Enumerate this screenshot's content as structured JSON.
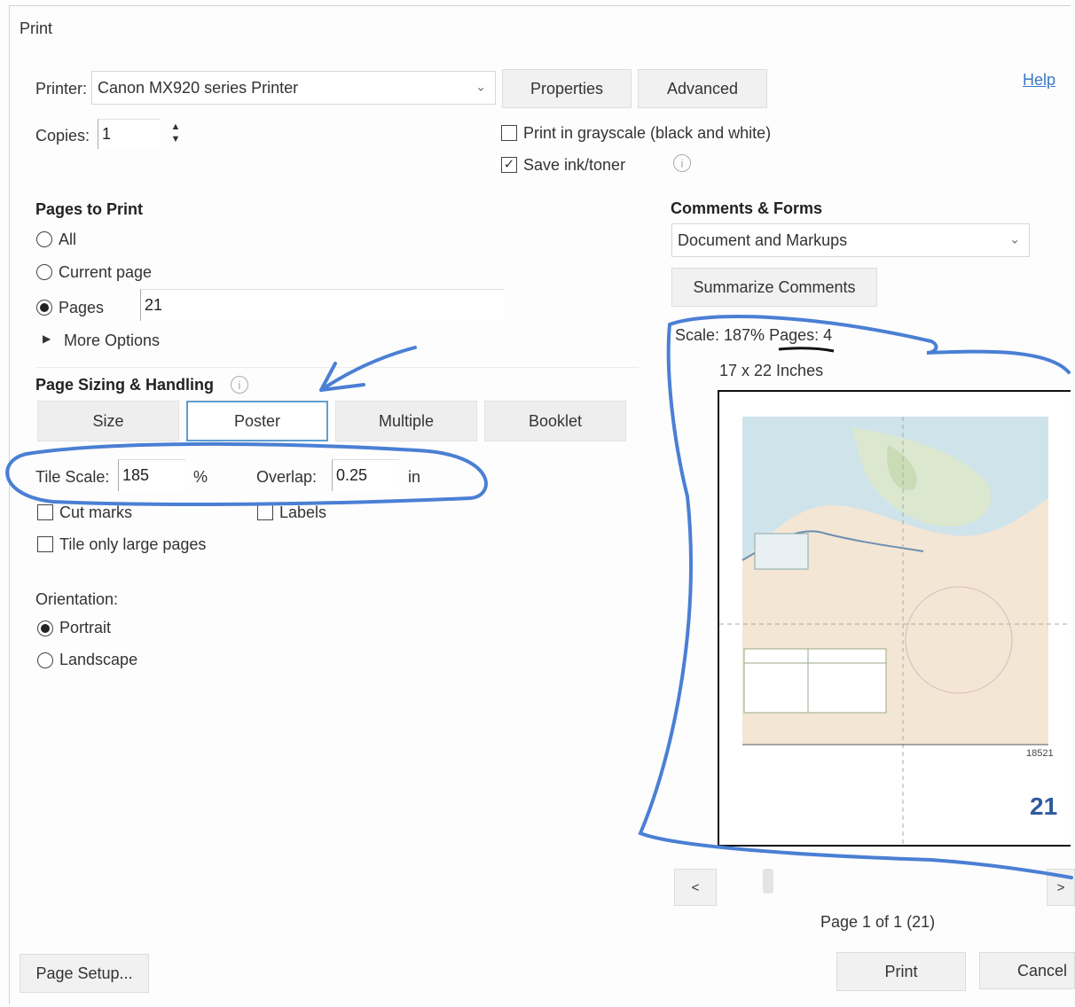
{
  "window": {
    "title": "Print"
  },
  "printer": {
    "label": "Printer:",
    "value": "Canon MX920 series Printer",
    "properties_button": "Properties",
    "advanced_button": "Advanced"
  },
  "help": {
    "label": "Help"
  },
  "copies": {
    "label": "Copies:",
    "value": "1"
  },
  "options": {
    "grayscale": "Print in grayscale (black and white)",
    "save_ink": "Save ink/toner"
  },
  "pages_to_print": {
    "heading": "Pages to Print",
    "all": "All",
    "current": "Current page",
    "pages": "Pages",
    "pages_value": "21",
    "more_options": "More Options"
  },
  "sizing": {
    "heading": "Page Sizing & Handling",
    "tabs": [
      {
        "label": "Size"
      },
      {
        "label": "Poster"
      },
      {
        "label": "Multiple"
      },
      {
        "label": "Booklet"
      }
    ],
    "tile_scale_label": "Tile Scale:",
    "tile_scale_value": "185",
    "tile_scale_unit": "%",
    "overlap_label": "Overlap:",
    "overlap_value": "0.25",
    "overlap_unit": "in",
    "cut_marks": "Cut marks",
    "labels": "Labels",
    "tile_large": "Tile only large pages"
  },
  "orientation": {
    "label": "Orientation:",
    "portrait": "Portrait",
    "landscape": "Landscape"
  },
  "comments_forms": {
    "heading": "Comments & Forms",
    "value": "Document and Markups",
    "summarize_button": "Summarize Comments"
  },
  "preview": {
    "scale_text": "Scale: 187% Pages: 4",
    "size_text": "17 x 22 Inches",
    "chart_number": "18521",
    "page_number": "21",
    "nav": {
      "prev": "<",
      "next": ">"
    },
    "page_indicator": "Page 1 of 1 (21)"
  },
  "footer": {
    "page_setup": "Page Setup...",
    "print": "Print",
    "cancel": "Cancel"
  },
  "colors": {
    "annotation_blue": "#4a7fd4",
    "tab_highlight": "#5f9ed1",
    "link": "#3b78c4"
  }
}
